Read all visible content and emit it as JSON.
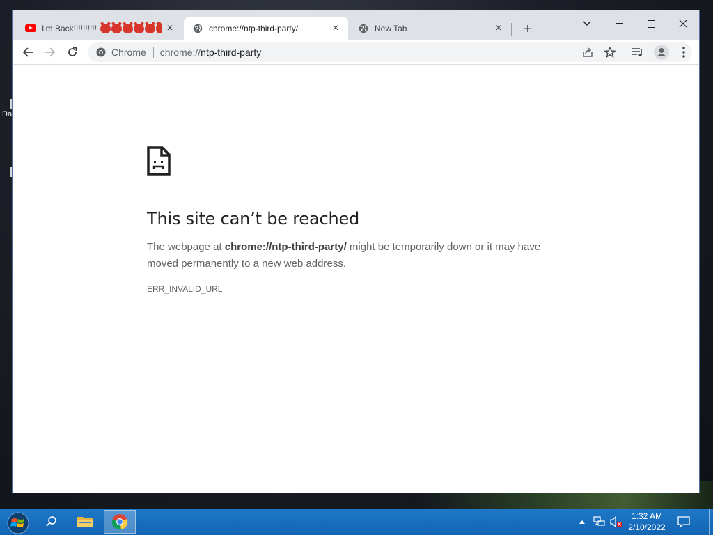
{
  "desktop": {
    "icon_label_fragment": "Da"
  },
  "tabs": [
    {
      "title": "I'm Back!!!!!!!!!!!",
      "favicon": "youtube-icon",
      "emoji_count": 6,
      "active": false
    },
    {
      "title": "chrome://ntp-third-party/",
      "favicon": "globe-icon",
      "active": true
    },
    {
      "title": "New Tab",
      "favicon": "globe-icon",
      "active": false
    }
  ],
  "toolbar": {
    "chip_label": "Chrome",
    "url_prefix": "chrome://",
    "url_host": "ntp-third-party"
  },
  "error_page": {
    "title": "This site can’t be reached",
    "desc_before": "The webpage at ",
    "desc_url": "chrome://ntp-third-party/",
    "desc_after": " might be temporarily down or it may have moved permanently to a new web address.",
    "code": "ERR_INVALID_URL"
  },
  "taskbar": {
    "time": "1:32 AM",
    "date": "2/10/2022"
  },
  "colors": {
    "tabstrip": "#dee1e6",
    "taskbar": "#1a6fbf",
    "title_text": "#202124",
    "body_text": "#5f6368"
  }
}
